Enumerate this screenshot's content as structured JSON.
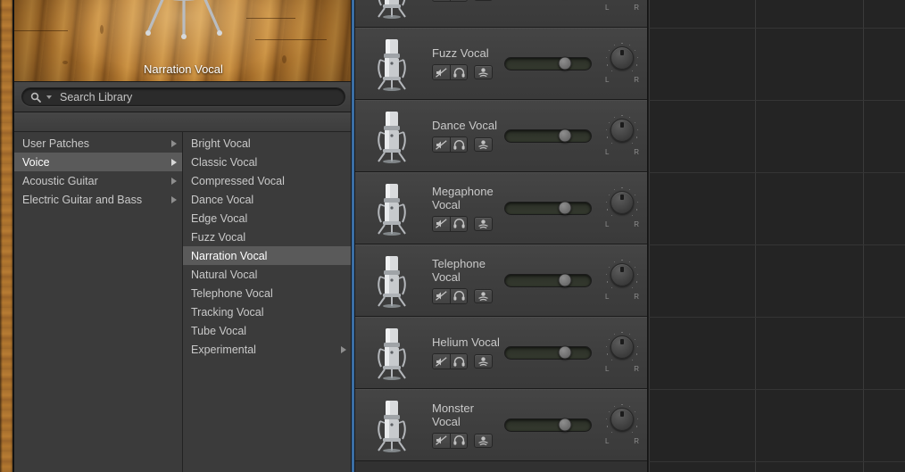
{
  "preview": {
    "patch_title": "Narration Vocal"
  },
  "search": {
    "placeholder": "Search Library",
    "value": "",
    "icon": "search-icon",
    "dropdown_icon": "chevron-down-icon"
  },
  "browser": {
    "categories": [
      {
        "label": "User Patches",
        "has_submenu": true,
        "selected": false
      },
      {
        "label": "Voice",
        "has_submenu": true,
        "selected": true
      },
      {
        "label": "Acoustic Guitar",
        "has_submenu": true,
        "selected": false
      },
      {
        "label": "Electric Guitar and Bass",
        "has_submenu": true,
        "selected": false
      }
    ],
    "patches": [
      {
        "label": "Bright Vocal",
        "has_submenu": false,
        "selected": false
      },
      {
        "label": "Classic Vocal",
        "has_submenu": false,
        "selected": false
      },
      {
        "label": "Compressed Vocal",
        "has_submenu": false,
        "selected": false
      },
      {
        "label": "Dance Vocal",
        "has_submenu": false,
        "selected": false
      },
      {
        "label": "Edge Vocal",
        "has_submenu": false,
        "selected": false
      },
      {
        "label": "Fuzz Vocal",
        "has_submenu": false,
        "selected": false
      },
      {
        "label": "Narration Vocal",
        "has_submenu": false,
        "selected": true
      },
      {
        "label": "Natural Vocal",
        "has_submenu": false,
        "selected": false
      },
      {
        "label": "Telephone Vocal",
        "has_submenu": false,
        "selected": false
      },
      {
        "label": "Tracking Vocal",
        "has_submenu": false,
        "selected": false
      },
      {
        "label": "Tube Vocal",
        "has_submenu": false,
        "selected": false
      },
      {
        "label": "Experimental",
        "has_submenu": true,
        "selected": false
      }
    ]
  },
  "strips": {
    "pan_left_label": "L",
    "pan_right_label": "R",
    "buttons": {
      "mute_icon": "mute-speaker-icon",
      "monitor_icon": "headphones-icon",
      "input_icon": "record-input-icon"
    },
    "tracks": [
      {
        "name": "",
        "volume_percent": 70,
        "pan": 0,
        "partial": true
      },
      {
        "name": "Fuzz Vocal",
        "volume_percent": 70,
        "pan": 0,
        "partial": false
      },
      {
        "name": "Dance Vocal",
        "volume_percent": 70,
        "pan": 0,
        "partial": false
      },
      {
        "name": "Megaphone Vocal",
        "volume_percent": 70,
        "pan": 0,
        "partial": false
      },
      {
        "name": "Telephone Vocal",
        "volume_percent": 70,
        "pan": 0,
        "partial": false
      },
      {
        "name": "Helium Vocal",
        "volume_percent": 70,
        "pan": 0,
        "partial": false
      },
      {
        "name": "Monster Vocal",
        "volume_percent": 70,
        "pan": 0,
        "partial": false
      }
    ]
  },
  "colors": {
    "panel_background": "#3b3b3b",
    "strip_background": "#414141",
    "selection": "#5a5a5a",
    "scroll_indicator": "#3b6ea5",
    "arrange_background": "#242424",
    "text_primary": "#c9c9c9",
    "text_selected": "#ffffff",
    "wood": "#b3782f"
  }
}
